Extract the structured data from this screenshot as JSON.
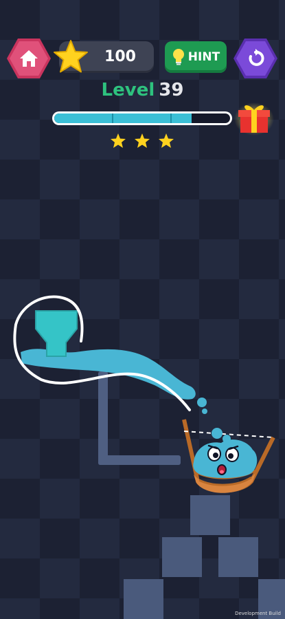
{
  "score": "100",
  "hint_label": "HINT",
  "level": {
    "label": "Level",
    "number": "39"
  },
  "progress": 0.78,
  "stars_earned": 3,
  "icons": [
    "home-icon",
    "star-icon",
    "lightbulb-icon",
    "undo-icon",
    "gift-icon"
  ],
  "colors": {
    "accent_green": "#2ec27e",
    "water": "#49b6d4",
    "home_button": "#e0517a",
    "undo_button": "#7b4ad9",
    "star": "#ffd21f"
  },
  "footer_note": "Development Build"
}
